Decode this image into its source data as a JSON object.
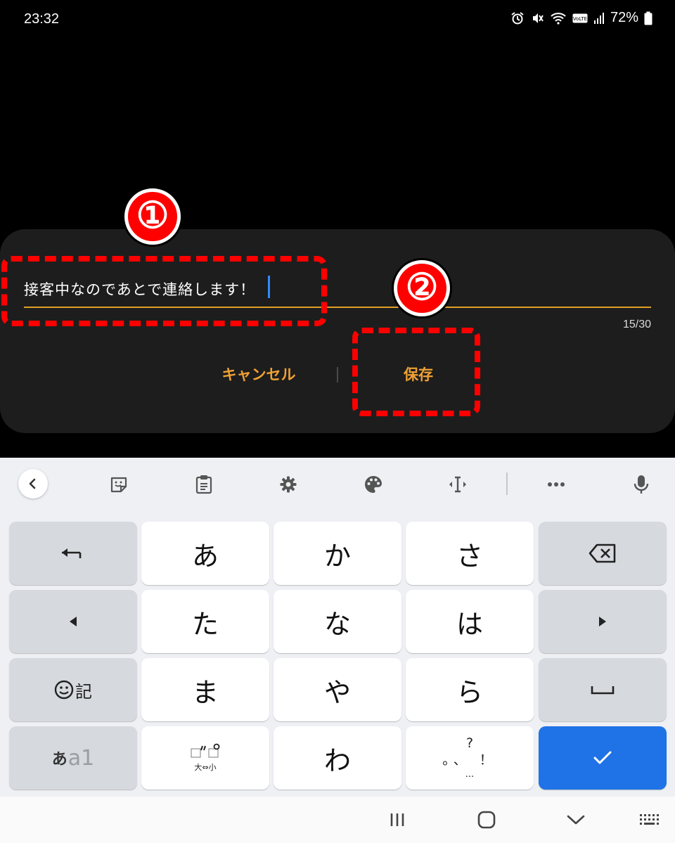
{
  "status_bar": {
    "time": "23:32",
    "battery_percent": "72%",
    "icons": [
      "alarm-icon",
      "vibrate-mute-icon",
      "wifi-icon",
      "volte-icon",
      "signal-icon",
      "battery-icon"
    ]
  },
  "dialog": {
    "text_value": "接客中なのであとで連絡します！",
    "char_count": "15/30",
    "cancel_label": "キャンセル",
    "save_label": "保存",
    "accent_color": "#f0a135",
    "underline_color": "#e0a025"
  },
  "annotations": {
    "marker_1": "①",
    "marker_2": "②",
    "color": "#ff0000"
  },
  "keyboard": {
    "toolbar_icons": [
      "back-chevron-icon",
      "sticker-icon",
      "clipboard-icon",
      "settings-gear-icon",
      "palette-icon",
      "cursor-move-icon",
      "more-dots-icon",
      "microphone-icon"
    ],
    "keys": {
      "a": "あ",
      "ka": "か",
      "sa": "さ",
      "ta": "た",
      "na": "な",
      "ha": "は",
      "ma": "ま",
      "ya": "や",
      "ra": "ら",
      "wa": "わ"
    },
    "emoji_key_label": "記",
    "mode_key_kana": "あ",
    "mode_key_alnum": "a1",
    "dakuten_key_label": "大⇔小",
    "punct_key_top": "?",
    "punct_key_middle": "。、 ！",
    "punct_key_bottom": "...",
    "enter_color": "#1f73e6"
  },
  "nav_bar": {
    "icons": [
      "recents-icon",
      "home-icon",
      "hide-keyboard-icon",
      "keyboard-switch-icon"
    ]
  }
}
